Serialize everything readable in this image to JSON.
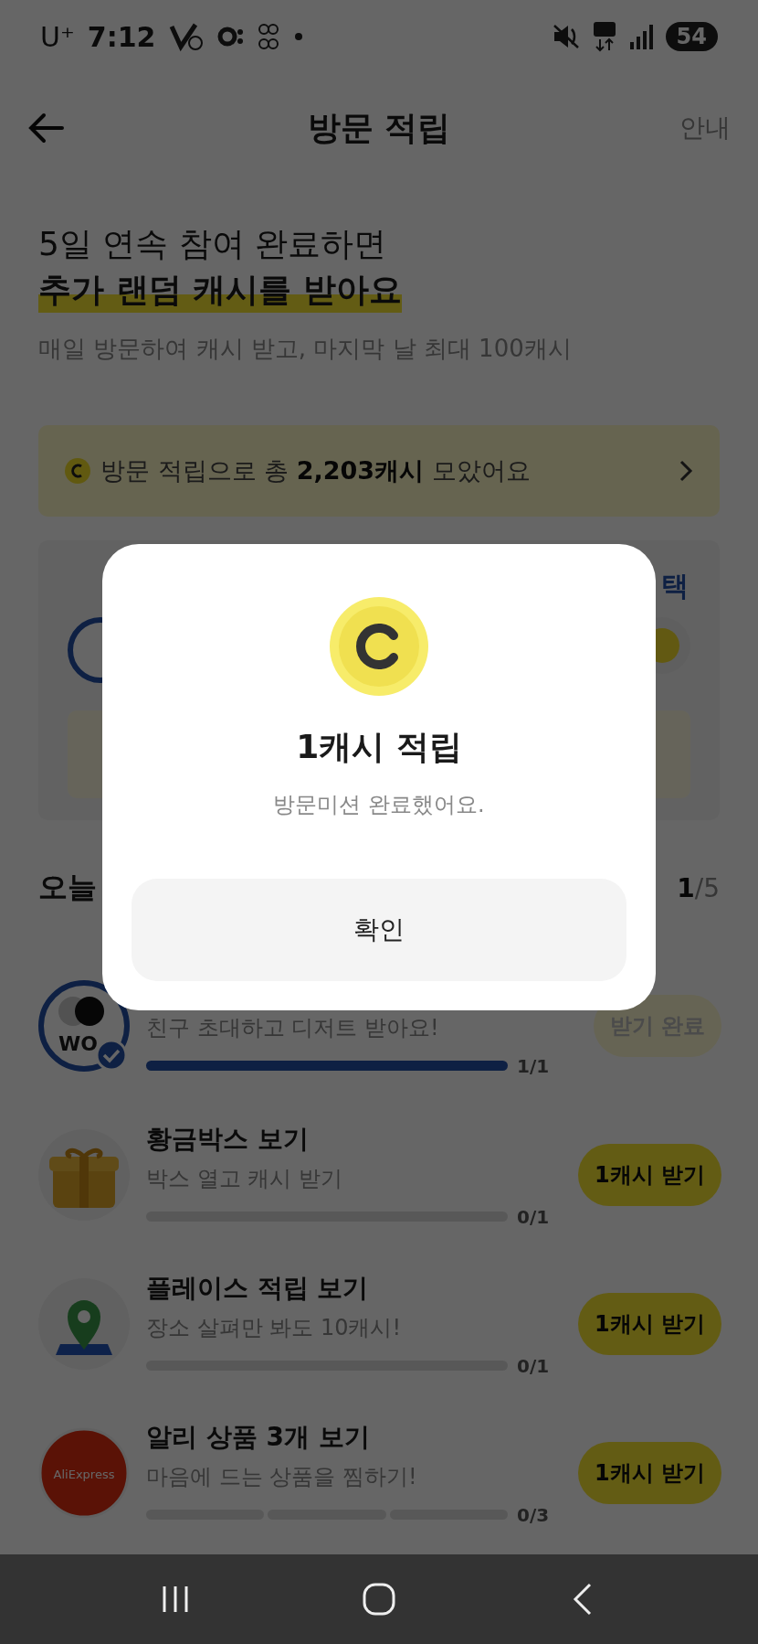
{
  "status_bar": {
    "carrier": "U⁺",
    "time": "7:12",
    "battery": "54"
  },
  "header": {
    "title": "방문 적립",
    "info_link": "안내"
  },
  "intro": {
    "line1": "5일 연속 참여 완료하면",
    "line2": "추가 랜덤 캐시를 받아요",
    "subtitle": "매일 방문하여 캐시 받고, 마지막 날 최대 100캐시"
  },
  "total_banner": {
    "text": "방문 적립으로 총 **2,203캐시** 모았어요"
  },
  "streak_card": {
    "corner_label": "택"
  },
  "modal": {
    "title": "1캐시 적립",
    "message": "방문미션 완료했어요.",
    "confirm": "확인"
  },
  "missions_header": {
    "title": "오늘",
    "done": "1",
    "total": "/5"
  },
  "missions": [
    {
      "kind": "wo",
      "logo_text": "WO",
      "checked": true,
      "subtitle": "친구 초대하고 디저트 받아요!",
      "segments": [
        {
          "filled": true
        }
      ],
      "reading": "1/1",
      "button": {
        "kind": "done",
        "label": "받기 완료"
      }
    },
    {
      "kind": "gift",
      "title": "황금박스 보기",
      "subtitle": "박스 열고 캐시 받기",
      "segments": [
        {
          "filled": false
        }
      ],
      "reading": "0/1",
      "button": {
        "kind": "claim",
        "label": "1캐시 받기"
      }
    },
    {
      "kind": "pin",
      "title": "플레이스 적립 보기",
      "subtitle": "장소 살펴만 봐도 10캐시!",
      "segments": [
        {
          "filled": false
        }
      ],
      "reading": "0/1",
      "button": {
        "kind": "claim",
        "label": "1캐시 받기"
      }
    },
    {
      "kind": "ali",
      "logo_text": "AliExpress",
      "title": "알리 상품 3개 보기",
      "subtitle": "마음에 드는 상품을 찜하기!",
      "segments": [
        {
          "filled": false
        },
        {
          "filled": false
        },
        {
          "filled": false
        }
      ],
      "reading": "0/3",
      "button": {
        "kind": "claim",
        "label": "1캐시 받기"
      }
    }
  ]
}
